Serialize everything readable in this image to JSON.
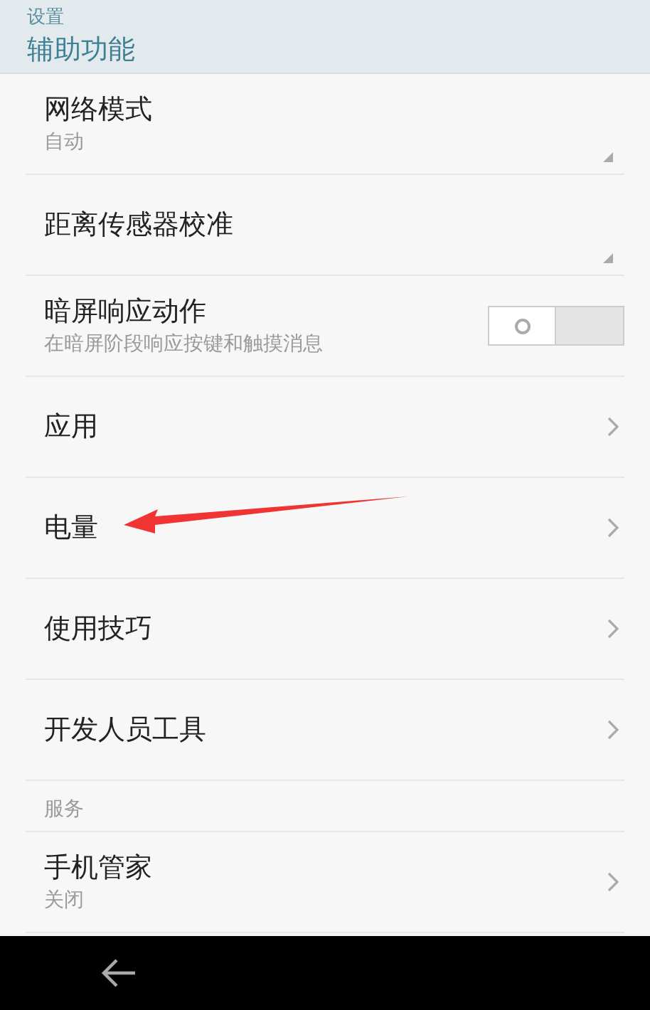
{
  "header": {
    "breadcrumb": "设置",
    "title": "辅助功能"
  },
  "sections": [
    {
      "items": [
        {
          "kind": "dropdown",
          "title": "网络模式",
          "summary": "自动"
        },
        {
          "kind": "dropdown",
          "title": "距离传感器校准"
        },
        {
          "kind": "toggle",
          "title": "暗屏响应动作",
          "summary": "在暗屏阶段响应按键和触摸消息",
          "on": false
        },
        {
          "kind": "link",
          "title": "应用"
        },
        {
          "kind": "link",
          "title": "电量",
          "annotated": true
        },
        {
          "kind": "link",
          "title": "使用技巧"
        },
        {
          "kind": "link",
          "title": "开发人员工具"
        }
      ]
    },
    {
      "heading": "服务",
      "items": [
        {
          "kind": "link",
          "title": "手机管家",
          "summary": "关闭"
        }
      ]
    }
  ]
}
